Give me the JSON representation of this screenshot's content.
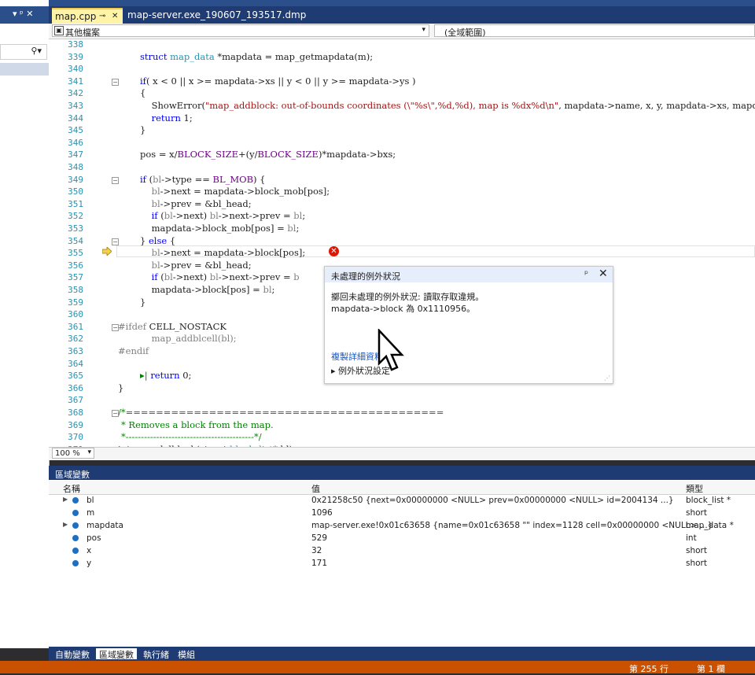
{
  "left_panel": {
    "controls": "▾ ᵖ ✕",
    "search_icon": "search-icon"
  },
  "tabs": [
    {
      "label": "map.cpp",
      "pin": "⊸",
      "close": "✕"
    },
    {
      "label": "map-server.exe_190607_193517.dmp"
    }
  ],
  "nav": {
    "left": "其他檔案",
    "right": "(全域範圍)"
  },
  "code": {
    "lines": [
      {
        "n": "338"
      },
      {
        "n": "339"
      },
      {
        "n": "340"
      },
      {
        "n": "341"
      },
      {
        "n": "342"
      },
      {
        "n": "343"
      },
      {
        "n": "344"
      },
      {
        "n": "345"
      },
      {
        "n": "346"
      },
      {
        "n": "347"
      },
      {
        "n": "348"
      },
      {
        "n": "349"
      },
      {
        "n": "350"
      },
      {
        "n": "351"
      },
      {
        "n": "352"
      },
      {
        "n": "353"
      },
      {
        "n": "354"
      },
      {
        "n": "355"
      },
      {
        "n": "356"
      },
      {
        "n": "357"
      },
      {
        "n": "358"
      },
      {
        "n": "359"
      },
      {
        "n": "360"
      },
      {
        "n": "361"
      },
      {
        "n": "362"
      },
      {
        "n": "363"
      },
      {
        "n": "364"
      },
      {
        "n": "365"
      },
      {
        "n": "366"
      },
      {
        "n": "367"
      },
      {
        "n": "368"
      },
      {
        "n": "369"
      },
      {
        "n": "370"
      },
      {
        "n": "371"
      }
    ]
  },
  "popup": {
    "title": "未處理的例外狀況",
    "pin": "ᵖ",
    "close": "✕",
    "line1": "擲回未處理的例外狀況: 讀取存取違規。",
    "line2": "mapdata->block 為 0x1110956。",
    "link": "複製詳細資料",
    "exception_settings": "▸ 例外狀況設定"
  },
  "zoom": "100 %",
  "locals": {
    "title": "區域變數",
    "headers": {
      "name": "名稱",
      "value": "值",
      "type": "類型"
    },
    "rows": [
      {
        "name": "bl",
        "value": "0x21258c50 {next=0x00000000 <NULL> prev=0x00000000 <NULL> id=2004134 ...}",
        "type": "block_list *",
        "expandable": true
      },
      {
        "name": "m",
        "value": "1096",
        "type": "short",
        "expandable": false
      },
      {
        "name": "mapdata",
        "value": "map-server.exe!0x01c63658 {name=0x01c63658 \"\" index=1128 cell=0x00000000 <NULL> ...}",
        "type": "map_data *",
        "expandable": true
      },
      {
        "name": "pos",
        "value": "529",
        "type": "int",
        "expandable": false
      },
      {
        "name": "x",
        "value": "32",
        "type": "short",
        "expandable": false
      },
      {
        "name": "y",
        "value": "171",
        "type": "short",
        "expandable": false
      }
    ]
  },
  "bottom_tabs": [
    "自動變數",
    "區域變數",
    "執行緒",
    "模組"
  ],
  "status": {
    "line": "第 255 行",
    "col": "第 1 欄"
  },
  "colors": {
    "accent": "#1f3b73",
    "status": "#ca5100",
    "tab_active": "#fff3a8",
    "error": "#e51400"
  }
}
